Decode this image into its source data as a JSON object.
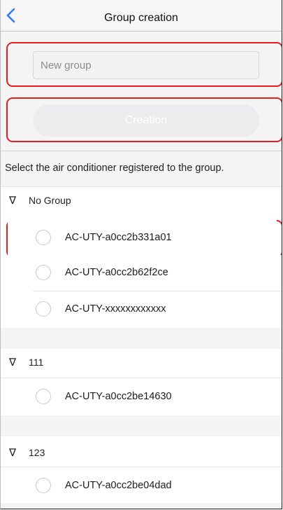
{
  "header": {
    "title": "Group creation",
    "back_icon": "chevron-left-icon",
    "accent": "#2f7cf6"
  },
  "form": {
    "group_name_placeholder": "New group",
    "group_name_value": "",
    "create_label": "Creation"
  },
  "instructions": "Select the air conditioner registered to the group.",
  "groups": [
    {
      "name": "No Group",
      "devices": [
        "AC-UTY-a0cc2b331a01",
        "AC-UTY-a0cc2b62f2ce",
        "AC-UTY-xxxxxxxxxxxx"
      ]
    },
    {
      "name": "111",
      "devices": [
        "AC-UTY-a0cc2be14630"
      ]
    },
    {
      "name": "123",
      "devices": [
        "AC-UTY-a0cc2be04dad"
      ]
    }
  ],
  "triangle_symbol": "∇",
  "highlight_color": "#e41e1e"
}
